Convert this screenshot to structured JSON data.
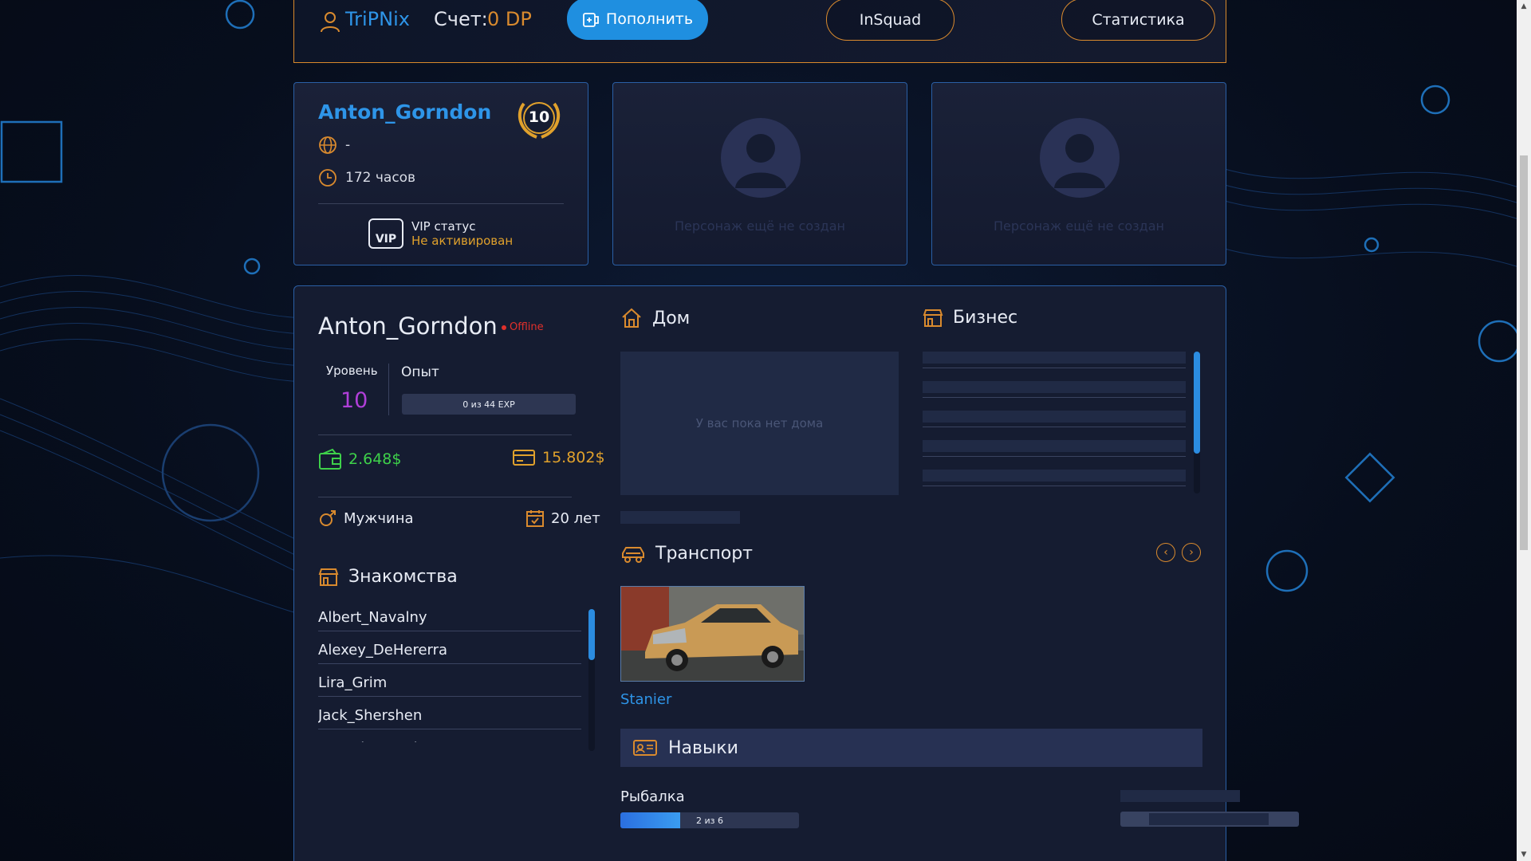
{
  "topbar": {
    "username": "TriPNix",
    "score_label": "Счет:",
    "score_value": "0 DP",
    "topup_label": "Пополнить",
    "insquad_label": "InSquad",
    "stats_label": "Статистика"
  },
  "characters": [
    {
      "name": "Anton_Gorndon",
      "level_badge": "10",
      "faction": "-",
      "hours": "172 часов",
      "vip_icon_text": "VIP",
      "vip_title": "VIP статус",
      "vip_state": "Не активирован"
    },
    {
      "empty_text": "Персонаж ещё не создан"
    },
    {
      "empty_text": "Персонаж ещё не создан"
    }
  ],
  "profile": {
    "name": "Anton_Gorndon",
    "status": "Offline",
    "level_label": "Уровень",
    "level_value": "10",
    "exp_label": "Опыт",
    "exp_text": "0 из 44 EXP",
    "cash": "2.648$",
    "bank": "15.802$",
    "gender": "Мужчина",
    "age": "20 лет",
    "friends_title": "Знакомства",
    "friends": [
      "Albert_Navalny",
      "Alexey_DeHererra",
      "Lira_Grim",
      "Jack_Shershen",
      "Antonio_Batalov"
    ]
  },
  "house": {
    "title": "Дом",
    "empty_text": "У вас пока нет дома"
  },
  "business": {
    "title": "Бизнес"
  },
  "transport": {
    "title": "Транспорт",
    "vehicle_name": "Stanier"
  },
  "skills": {
    "title": "Навыки",
    "items": [
      {
        "name": "Рыбалка",
        "progress_text": "2 из 6",
        "fraction": 0.333
      }
    ]
  },
  "colors": {
    "accent_blue": "#2e95e8",
    "accent_orange": "#d98a2e",
    "cash_green": "#3ed14a",
    "level_purple": "#b03fd8",
    "offline_red": "#e0302b"
  }
}
